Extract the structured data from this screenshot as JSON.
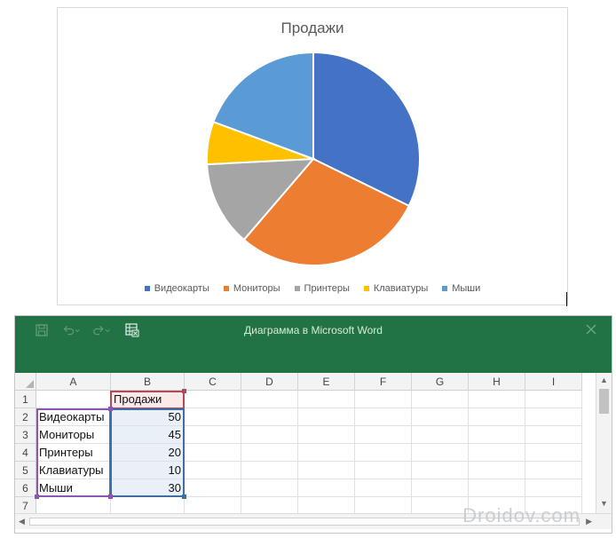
{
  "chart_data": {
    "type": "pie",
    "title": "Продажи",
    "categories": [
      "Видеокарты",
      "Мониторы",
      "Принтеры",
      "Клавиатуры",
      "Мыши"
    ],
    "values": [
      50,
      45,
      20,
      10,
      30
    ],
    "colors": [
      "#4472c4",
      "#ed7d31",
      "#a5a5a5",
      "#ffc000",
      "#5b9bd5"
    ],
    "legend_position": "bottom",
    "start_angle": "12 o'clock, clockwise"
  },
  "excel": {
    "window_title": "Диаграмма в Microsoft Word",
    "accent_color": "#217346",
    "toolbar_icons": [
      "save-icon",
      "undo-icon",
      "redo-icon",
      "edit-data-icon"
    ],
    "columns": [
      "A",
      "B",
      "C",
      "D",
      "E",
      "F",
      "G",
      "H",
      "I"
    ],
    "rows": [
      {
        "num": "1",
        "a": "",
        "b": "Продажи"
      },
      {
        "num": "2",
        "a": "Видеокарты",
        "b": "50"
      },
      {
        "num": "3",
        "a": "Мониторы",
        "b": "45"
      },
      {
        "num": "4",
        "a": "Принтеры",
        "b": "20"
      },
      {
        "num": "5",
        "a": "Клавиатуры",
        "b": "10"
      },
      {
        "num": "6",
        "a": "Мыши",
        "b": "30"
      },
      {
        "num": "7",
        "a": "",
        "b": ""
      }
    ]
  },
  "watermark": "Droidov.com"
}
